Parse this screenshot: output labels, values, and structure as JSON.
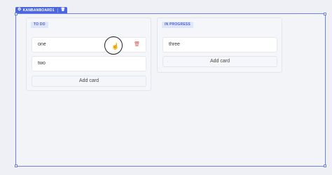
{
  "component": {
    "name": "KANBANBOARD1",
    "settings_icon": "gear-icon",
    "delete_icon": "trash-icon"
  },
  "columns": [
    {
      "label": "TO DO",
      "cards": [
        {
          "text": "one",
          "delete_icon": "trash-icon"
        },
        {
          "text": "two"
        }
      ],
      "add_label": "Add card"
    },
    {
      "label": "IN PROGRESS",
      "cards": [
        {
          "text": "three"
        }
      ],
      "add_label": "Add card"
    }
  ],
  "cursor_icon": "hand-pointer-icon",
  "colors": {
    "accent": "#4c66e0",
    "danger": "#e05252",
    "background": "#eef0f5"
  }
}
